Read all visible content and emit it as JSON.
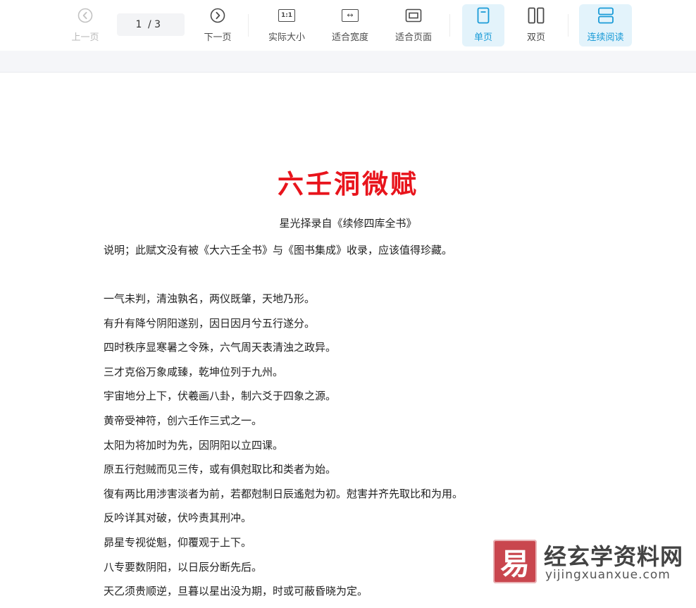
{
  "toolbar": {
    "prev_label": "上一页",
    "page_current": "1",
    "page_total": "/ 3",
    "next_label": "下一页",
    "actual_size_label": "实际大小",
    "fit_width_label": "适合宽度",
    "fit_page_label": "适合页面",
    "single_page_label": "单页",
    "double_page_label": "双页",
    "continuous_label": "连续阅读",
    "actual_size_glyph": "1:1",
    "fit_width_glyph": "↔",
    "accent_color": "#1a9bd7"
  },
  "document": {
    "title": "六壬洞微赋",
    "title_color": "#e8141c",
    "subtitle": "星光择录自《续修四库全书》",
    "note": "说明；此赋文没有被《大六壬全书》与《图书集成》收录，应该值得珍藏。",
    "lines": [
      "一气未判，清浊孰名，两仪既肇，天地乃形。",
      "有升有降兮阴阳遂别，因日因月兮五行遂分。",
      "四时秩序显寒暑之令殊，六气周天表清浊之政异。",
      "三才克俗万象咸臻，乾坤位列于九州。",
      "宇宙地分上下，伏羲画八卦，制六爻于四象之源。",
      "黄帝受神符，创六壬作三式之一。",
      "太阳为将加时为先，因阴阳以立四课。",
      "原五行尅贼而见三传，或有俱尅取比和类者为始。",
      "復有两比用涉害淡者为前，若都尅制日辰遙尅为初。尅害并齐先取比和为用。",
      "反吟详其对破，伏吟责其刑冲。",
      "昴星专视從魁，仰覆观于上下。",
      "八专要数阴阳，以日辰分断先后。",
      "天乙须贵顺逆，旦暮以星出没为期，时或可蔽昏晓为定。"
    ]
  },
  "watermark": {
    "logo_glyph": "易",
    "name": "经玄学资料网",
    "url": "yijingxuanxue.com"
  }
}
